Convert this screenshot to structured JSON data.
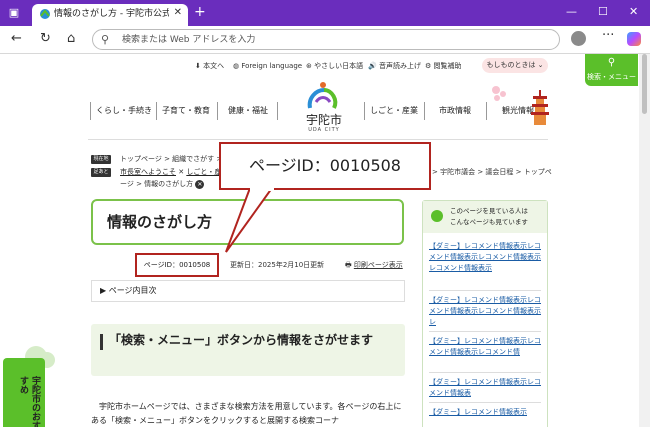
{
  "browser": {
    "tab_title": "情報のさがし方 - 宇陀市公式ホームページ",
    "address_placeholder": "検索または Web アドレスを入力"
  },
  "header": {
    "util_links": [
      "本文へ",
      "Foreign language",
      "やさしい日本語",
      "音声読み上げ",
      "閲覧補助"
    ],
    "emergency_button": "もしものときは",
    "search_menu_label": "検索・メニュー",
    "logo_text": "宇陀市",
    "logo_en": "UDA CITY",
    "nav_left": [
      "くらし・手続き",
      "子育て・教育",
      "健康・福祉"
    ],
    "nav_right": [
      "しごと・産業",
      "市政情報",
      "観光情報"
    ]
  },
  "breadcrumbs": {
    "tag1": "現在地",
    "tag2": "足あと",
    "line1": "トップページ > 組織でさがす >",
    "line2a": "市長室へようこそ",
    "line2b": "しごと・産",
    "line2c": "> 宇陀市議会 > 議会日程 > トップペ",
    "line3": "ージ > 情報のさがし方"
  },
  "main": {
    "title": "情報のさがし方",
    "page_id": "ページID：0010508",
    "updated": "更新日：2025年2月10日更新",
    "print": "印刷ページ表示",
    "toc": "ページ内目次",
    "section_heading": "「検索・メニュー」ボタンから情報をさがせます",
    "body": "宇陀市ホームページでは、さまざまな検索方法を用意しています。各ページの右上にある「検索・メニュー」ボタンをクリックすると展開する検索コーナ"
  },
  "callout": {
    "text": "ページID：0010508"
  },
  "recommend": {
    "heading": "このページを見ている人はこんなページも見ています",
    "items": [
      "【ダミー】レコメンド情報表示レコメンド情報表示レコメンド情報表示レコメンド情報表示",
      "【ダミー】レコメンド情報表示レコメンド情報表示レコメンド情報表示レ",
      "【ダミー】レコメンド情報表示レコメンド情報表示レコメンド情",
      "【ダミー】レコメンド情報表示レコメンド情報表",
      "【ダミー】レコメンド情報表示"
    ]
  },
  "osusume": {
    "text": "宇陀市のおすすめ"
  }
}
